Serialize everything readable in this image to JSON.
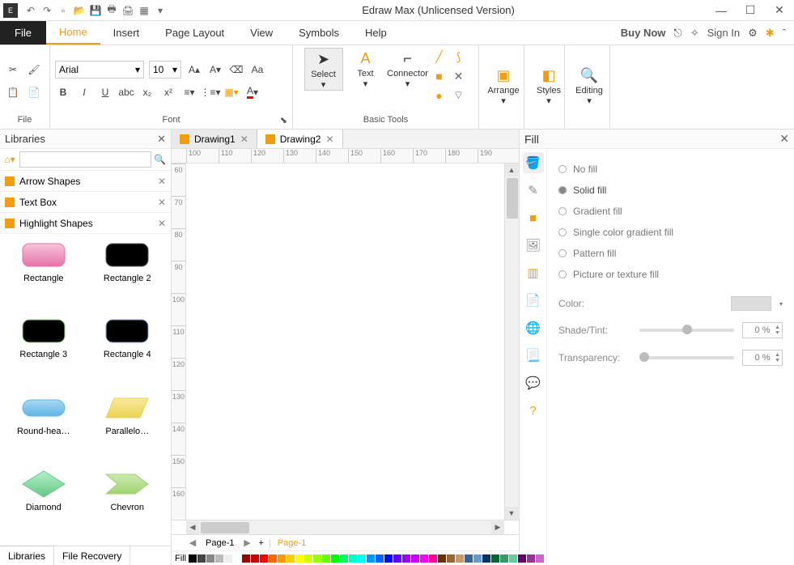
{
  "title": "Edraw Max (Unlicensed Version)",
  "menu": {
    "file": "File",
    "tabs": [
      "Home",
      "Insert",
      "Page Layout",
      "View",
      "Symbols",
      "Help"
    ],
    "active": "Home",
    "buy_now": "Buy Now",
    "sign_in": "Sign In"
  },
  "ribbon": {
    "file_group": "File",
    "font_group": "Font",
    "font_name": "Arial",
    "font_size": "10",
    "basic_tools_group": "Basic Tools",
    "select": "Select",
    "text": "Text",
    "connector": "Connector",
    "arrange": "Arrange",
    "styles": "Styles",
    "editing": "Editing"
  },
  "libraries": {
    "title": "Libraries",
    "search_placeholder": "",
    "categories": [
      "Arrow Shapes",
      "Text Box",
      "Highlight Shapes"
    ],
    "shapes": [
      {
        "label": "Rectangle",
        "color1": "#f8c4da",
        "color2": "#e672a8",
        "shape": "rrect"
      },
      {
        "label": "Rectangle 2",
        "color1": "#9fa5ad",
        "color2": "#555a63",
        "shape": "rrect"
      },
      {
        "label": "Rectangle 3",
        "color1": "#c9efc1",
        "color2": "#8fd97f",
        "shape": "rrect"
      },
      {
        "label": "Rectangle 4",
        "color1": "#c3cdf2",
        "color2": "#8ea1df",
        "shape": "rrect"
      },
      {
        "label": "Round-hea…",
        "color1": "#a9d8f3",
        "color2": "#5fb5e6",
        "shape": "pill"
      },
      {
        "label": "Parallelo…",
        "color1": "#f7e9a0",
        "color2": "#ecd34f",
        "shape": "para"
      },
      {
        "label": "Diamond",
        "color1": "#b7eec7",
        "color2": "#62c986",
        "shape": "diamond"
      },
      {
        "label": "Chevron",
        "color1": "#cdeab2",
        "color2": "#9fd46e",
        "shape": "chevron"
      }
    ],
    "bottom_tabs": [
      "Libraries",
      "File Recovery"
    ]
  },
  "documents": {
    "tabs": [
      "Drawing1",
      "Drawing2"
    ],
    "active": "Drawing2",
    "ruler_h": [
      "100",
      "110",
      "120",
      "130",
      "140",
      "150",
      "160",
      "170",
      "180",
      "190"
    ],
    "ruler_v": [
      "60",
      "70",
      "80",
      "90",
      "100",
      "110",
      "120",
      "130",
      "140",
      "150",
      "160"
    ],
    "pages": [
      "Page-1",
      "Page-1"
    ]
  },
  "fill_panel": {
    "title": "Fill",
    "options": [
      "No fill",
      "Solid fill",
      "Gradient fill",
      "Single color gradient fill",
      "Pattern fill",
      "Picture or texture fill"
    ],
    "selected": "Solid fill",
    "color_label": "Color:",
    "shade_label": "Shade/Tint:",
    "shade_value": "0 %",
    "trans_label": "Transparency:",
    "trans_value": "0 %"
  },
  "statusbar": {
    "fill_label": "Fill"
  },
  "swatches": [
    "#000",
    "#444",
    "#888",
    "#bbb",
    "#eee",
    "#fff",
    "#900",
    "#c00",
    "#f00",
    "#f60",
    "#f90",
    "#fc0",
    "#ff0",
    "#cf0",
    "#9f0",
    "#6f0",
    "#0f0",
    "#0f6",
    "#0fc",
    "#0ff",
    "#09f",
    "#06f",
    "#00f",
    "#60f",
    "#90f",
    "#c0f",
    "#f0f",
    "#f09",
    "#630",
    "#963",
    "#c96",
    "#369",
    "#69c",
    "#036",
    "#063",
    "#396",
    "#6c9",
    "#606",
    "#939",
    "#c6c"
  ]
}
